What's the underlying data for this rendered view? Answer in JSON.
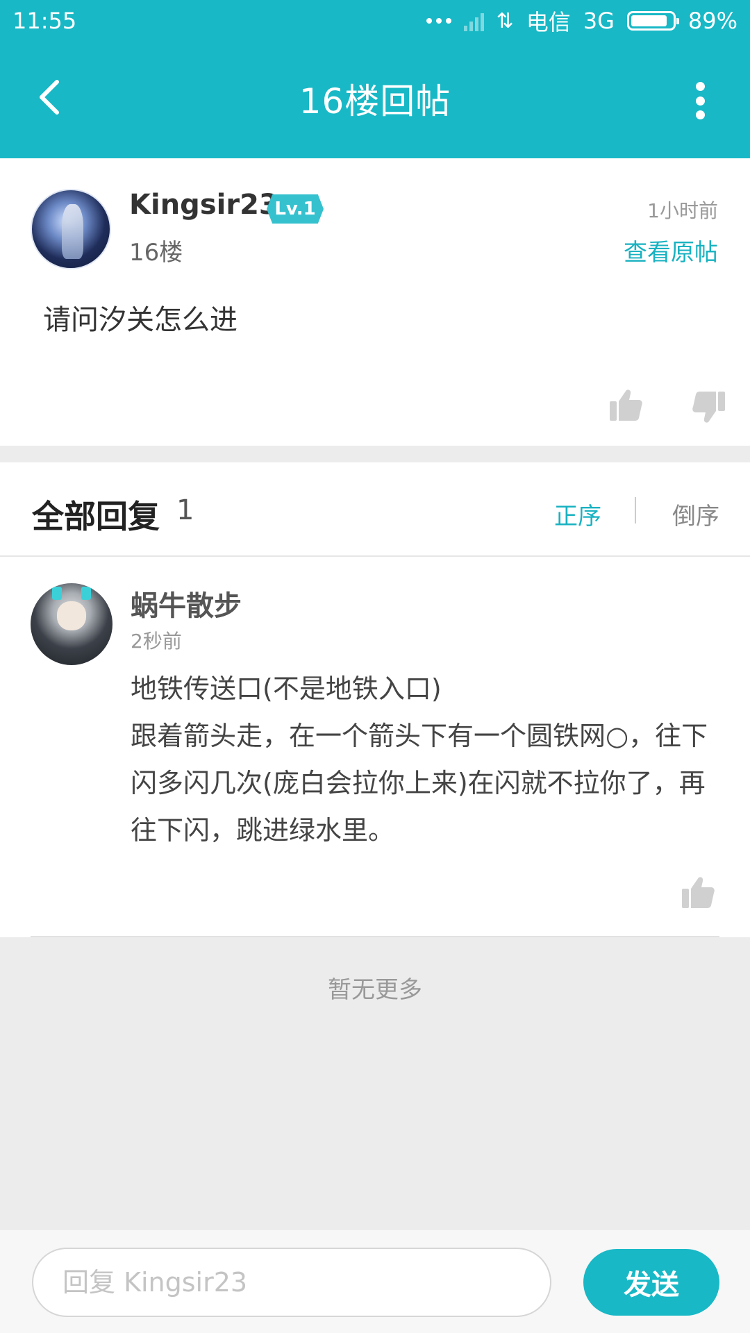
{
  "status_bar": {
    "time": "11:55",
    "carrier": "电信",
    "network": "3G",
    "battery": "89%",
    "battery_level": 0.89
  },
  "header": {
    "title": "16楼回帖",
    "back_icon": "chevron-left-icon",
    "more_icon": "vertical-dots-icon"
  },
  "post": {
    "username": "Kingsir23",
    "level": "Lv.1",
    "floor": "16楼",
    "time": "1小时前",
    "view_original": "查看原帖",
    "content": "请问汐关怎么进"
  },
  "replies": {
    "label": "全部回复",
    "count": "1",
    "sort_asc": "正序",
    "sort_desc": "倒序",
    "items": [
      {
        "username": "蜗牛散步",
        "time": "2秒前",
        "text": "地铁传送口(不是地铁入口)\n跟着箭头走，在一个箭头下有一个圆铁网○，往下闪多闪几次(庞白会拉你上来)在闪就不拉你了，再往下闪，跳进绿水里。"
      }
    ],
    "no_more": "暂无更多"
  },
  "composer": {
    "placeholder": "回复 Kingsir23",
    "send_label": "发送"
  },
  "colors": {
    "accent": "#18b8c6",
    "link": "#18b2c1",
    "background": "#ececec"
  }
}
